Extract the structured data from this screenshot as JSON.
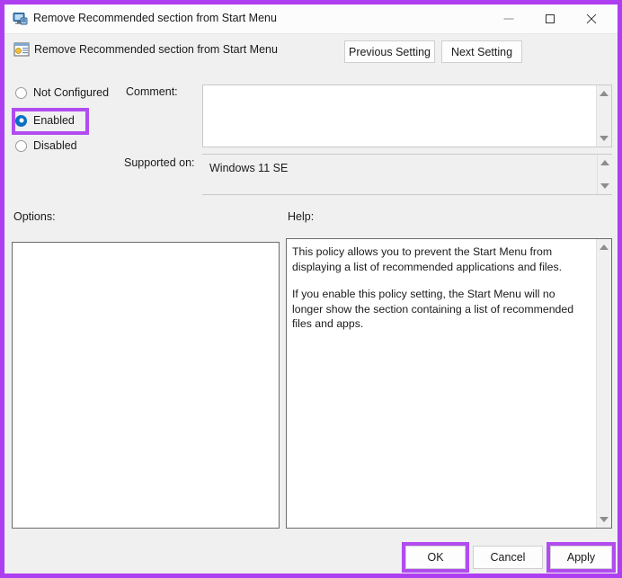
{
  "window": {
    "title": "Remove Recommended section from Start Menu",
    "title_icon": "computer-policy-icon",
    "controls": {
      "minimize": "minimize-icon",
      "maximize": "maximize-icon",
      "close": "close-icon"
    }
  },
  "header": {
    "policy_icon": "policy-setting-icon",
    "policy_title": "Remove Recommended section from Start Menu",
    "previous_setting": "Previous Setting",
    "next_setting": "Next Setting"
  },
  "state": {
    "options": [
      {
        "label": "Not Configured",
        "selected": false
      },
      {
        "label": "Enabled",
        "selected": true
      },
      {
        "label": "Disabled",
        "selected": false
      }
    ],
    "selected_value": "Enabled"
  },
  "comment": {
    "label": "Comment:",
    "value": "",
    "placeholder": ""
  },
  "supported": {
    "label": "Supported on:",
    "value": "Windows 11 SE"
  },
  "panels": {
    "options_label": "Options:",
    "options_content": "",
    "help_label": "Help:",
    "help_paragraphs": [
      "This policy allows you to prevent the Start Menu from displaying a list of recommended applications and files.",
      "If you enable this policy setting, the Start Menu will no longer show the section containing a list of recommended files and apps."
    ]
  },
  "footer": {
    "ok": "OK",
    "cancel": "Cancel",
    "apply": "Apply"
  },
  "colors": {
    "highlight_purple": "#b14cf0",
    "frame_purple": "#ae3ff0",
    "radio_blue": "#0a6fc2",
    "dialog_background": "#f0f0f0",
    "titlebar_background": "#fcfcfc"
  }
}
